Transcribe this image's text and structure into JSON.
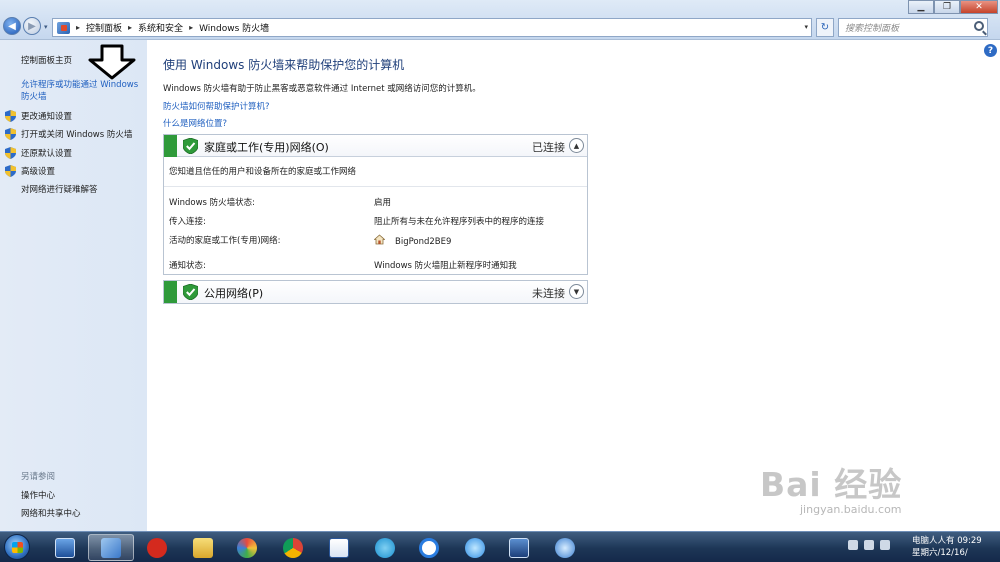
{
  "window_controls": {
    "minimize": "▁",
    "maximize": "❐",
    "close": "✕"
  },
  "nav": {
    "back_icon": "◀",
    "forward_icon": "▶",
    "dropdown_icon": "▾",
    "refresh_icon": "↻"
  },
  "address_bar": {
    "crumbs": [
      "控制面板",
      "系统和安全",
      "Windows 防火墙"
    ],
    "separator": "▸",
    "dropdown_icon": "▾"
  },
  "search": {
    "placeholder": "搜索控制面板"
  },
  "sidebar": {
    "home": "控制面板主页",
    "allow_program": "允许程序或功能通过 Windows 防火墙",
    "items": [
      {
        "label": "更改通知设置",
        "icon": "uac-shield-icon"
      },
      {
        "label": "打开或关闭 Windows 防火墙",
        "icon": "uac-shield-icon"
      },
      {
        "label": "还原默认设置",
        "icon": "uac-shield-icon"
      },
      {
        "label": "高级设置",
        "icon": "uac-shield-icon"
      }
    ],
    "troubleshoot": "对网络进行疑难解答",
    "see_also_label": "另请参阅",
    "see_also": [
      "操作中心",
      "网络和共享中心"
    ]
  },
  "main": {
    "help_icon": "?",
    "title": "使用 Windows 防火墙来帮助保护您的计算机",
    "description": "Windows 防火墙有助于防止黑客或恶意软件通过 Internet 或网络访问您的计算机。",
    "links": [
      "防火墙如何帮助保护计算机?",
      "什么是网络位置?"
    ]
  },
  "home_panel": {
    "title": "家庭或工作(专用)网络(O)",
    "status": "已连接",
    "collapse_icon": "▲",
    "subtitle": "您知道且信任的用户和设备所在的家庭或工作网络",
    "rows": [
      {
        "label": "Windows 防火墙状态:",
        "value": "启用"
      },
      {
        "label": "传入连接:",
        "value": "阻止所有与未在允许程序列表中的程序的连接"
      },
      {
        "label": "活动的家庭或工作(专用)网络:",
        "value": "BigPond2BE9"
      },
      {
        "label": "通知状态:",
        "value": "Windows 防火墙阻止新程序时通知我"
      }
    ]
  },
  "public_panel": {
    "title": "公用网络(P)",
    "status": "未连接",
    "expand_icon": "▼"
  },
  "taskbar": {
    "clock_line1": "电脑人人有 09:29",
    "clock_line2": "星期六/12/16/"
  },
  "watermark": {
    "text": "Bai 经验",
    "url": "jingyan.baidu.com"
  }
}
